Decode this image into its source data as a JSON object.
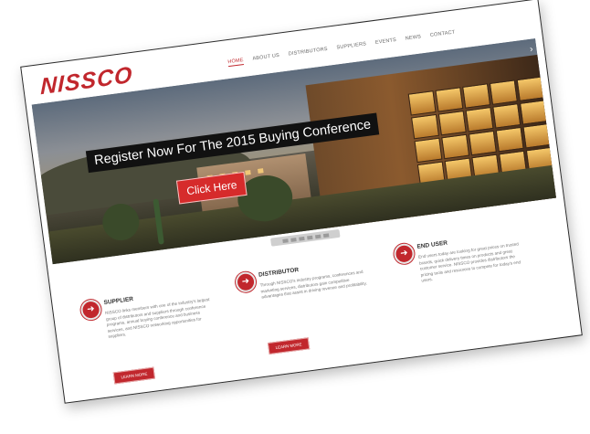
{
  "header": {
    "logo": "NISSCO",
    "nav": [
      "HOME",
      "ABOUT US",
      "DISTRIBUTORS",
      "SUPPLIERS",
      "EVENTS",
      "NEWS",
      "CONTACT"
    ]
  },
  "hero": {
    "headline": "Register Now For The 2015 Buying Conference",
    "cta": "Click Here",
    "arrow": "›"
  },
  "columns": [
    {
      "title": "SUPPLIER",
      "text": "NISSCO links members with one of the industry's largest group of distributors and suppliers through conference programs, annual buying conference and business services, and NISSCO networking opportunities for suppliers.",
      "button": "LEARN MORE"
    },
    {
      "title": "DISTRIBUTOR",
      "text": "Through NISSCO's industry programs, conferences and marketing services, distributors gain competitive advantages that assist in driving revenue and profitability.",
      "button": "LEARN MORE"
    },
    {
      "title": "END USER",
      "text": "End users today are looking for great prices on trusted brands, quick delivery times on products and great customer service. NISSCO provides distributors the pricing tools and resources to compete for today's end users.",
      "button": ""
    }
  ],
  "colors": {
    "brand": "#c1272d",
    "headline_bg": "#111111",
    "cta_bg": "#d62b2b"
  }
}
